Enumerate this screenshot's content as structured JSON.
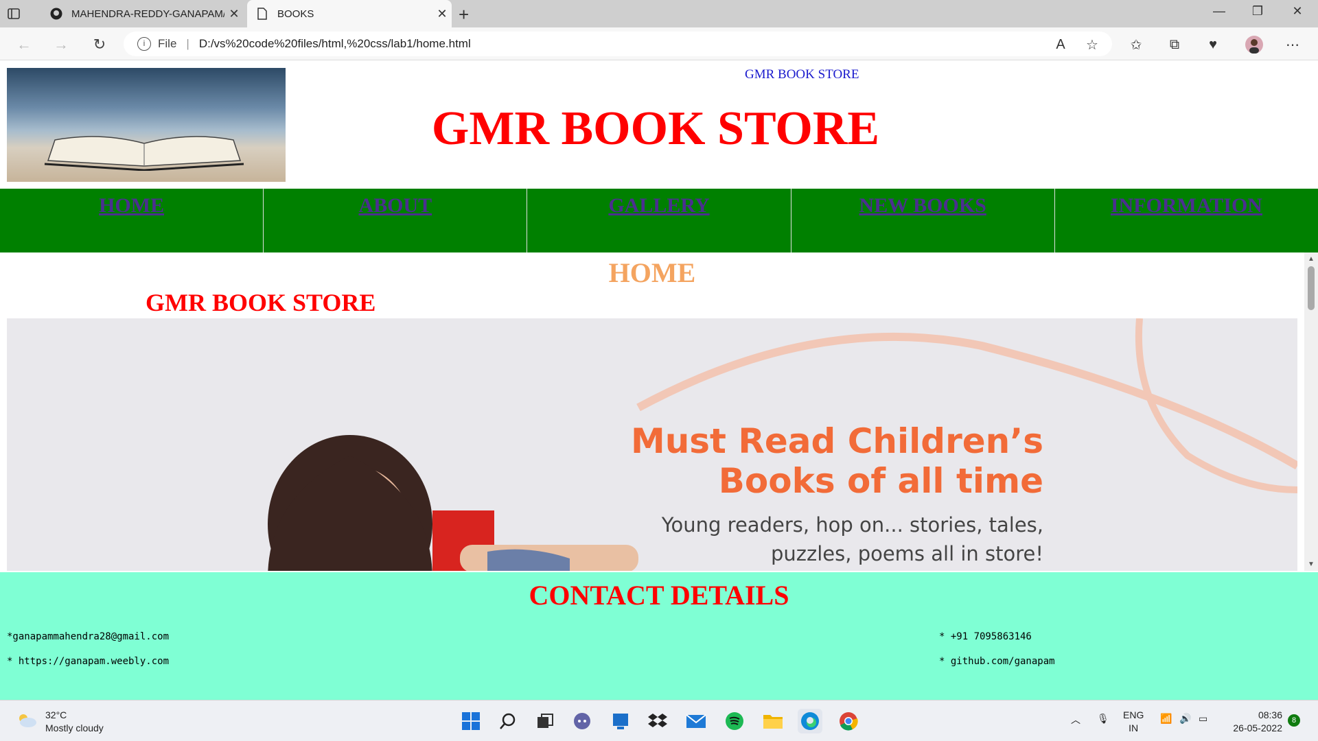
{
  "browser": {
    "tabs": [
      {
        "title": "MAHENDRA-REDDY-GANAPAM/",
        "active": false
      },
      {
        "title": "BOOKS",
        "active": true
      }
    ],
    "url_scheme": "File",
    "url": "D:/vs%20code%20files/html,%20css/lab1/home.html"
  },
  "header": {
    "top_link": "GMR BOOK STORE",
    "title": "GMR BOOK STORE"
  },
  "nav": {
    "items": [
      "HOME",
      "ABOUT",
      "GALLERY",
      "NEW BOOKS",
      "INFORMATION"
    ],
    "bg_color": "#008000",
    "link_color": "#4b2f8f"
  },
  "home": {
    "heading": "HOME",
    "subheading": "GMR BOOK STORE",
    "banner_title_line1": "Must Read Children’s",
    "banner_title_line2": "Books of all time",
    "banner_text_line1": "Young readers, hop on... stories, tales,",
    "banner_text_line2": "puzzles, poems all in store!"
  },
  "contact": {
    "title": "CONTACT DETAILS",
    "email": "*ganapammahendra28@gmail.com",
    "website": "* https://ganapam.weebly.com",
    "phone": "* +91 7095863146",
    "github": "* github.com/ganapam",
    "bg_color": "#7fffd4"
  },
  "taskbar": {
    "temperature": "32°C",
    "weather": "Mostly cloudy",
    "lang1": "ENG",
    "lang2": "IN",
    "time": "08:36",
    "date": "26-05-2022",
    "notifications": "8"
  }
}
